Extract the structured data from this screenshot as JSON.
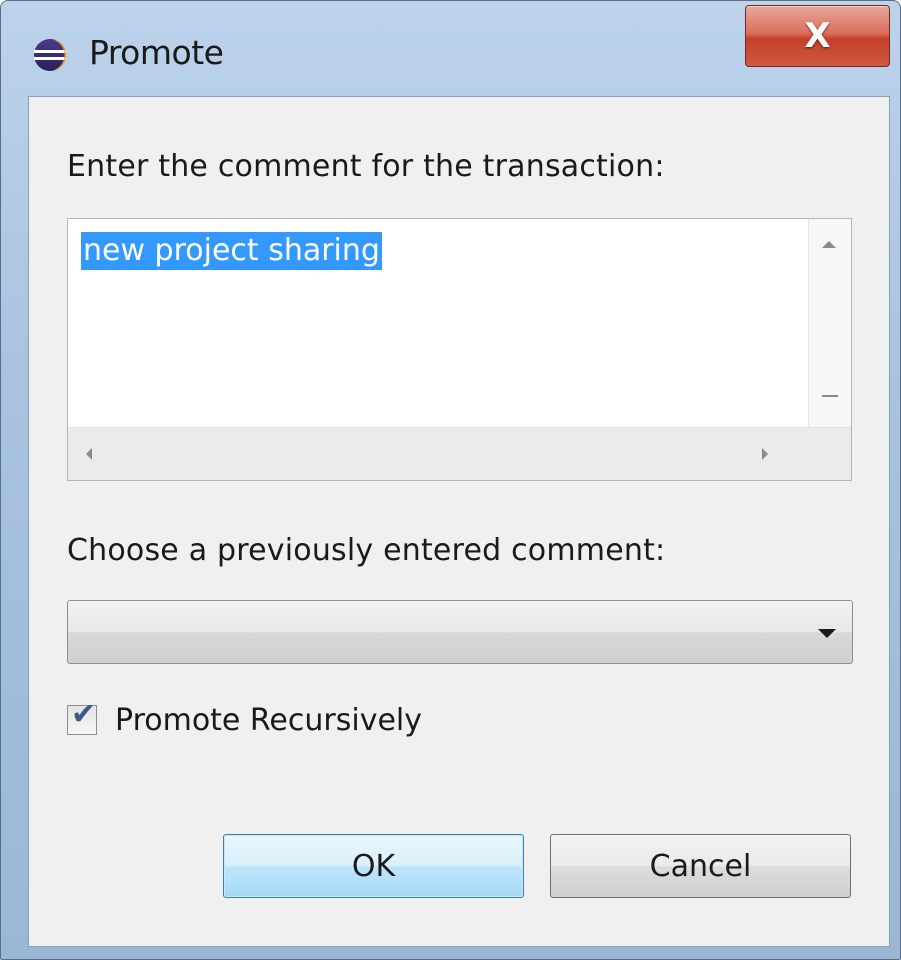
{
  "window": {
    "title": "Promote",
    "close_glyph": "X",
    "app_icon": "eclipse-icon",
    "close_icon": "close-icon"
  },
  "dialog": {
    "comment_prompt": "Enter the comment for the transaction:",
    "comment_value": "new project sharing",
    "history_prompt": "Choose a previously entered comment:",
    "history_selected": "",
    "recursive_label": "Promote Recursively",
    "recursive_checked": true,
    "ok_label": "OK",
    "cancel_label": "Cancel"
  },
  "colors": {
    "selection": "#3399ff",
    "close_button": "#c4402a",
    "default_button_border": "#3c7fb1"
  }
}
